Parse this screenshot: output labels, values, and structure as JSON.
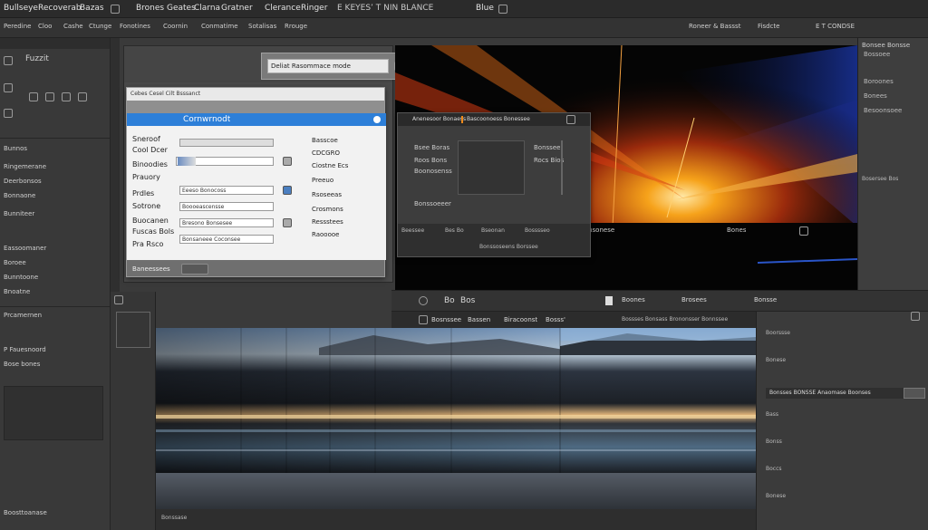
{
  "menubar": {
    "items": [
      "Bullseye",
      "Recoverab",
      "Bazas",
      "Brones",
      "Geates",
      "Clarna",
      "Gratner",
      "Clerance",
      "Ringer",
      "Blue"
    ],
    "right_text": "E KEYES’ T NIN BLANCE"
  },
  "toolbar": {
    "items": [
      "Peredine",
      "Cloo",
      "Cashe",
      "Ctunge",
      "Fonotines",
      "Coornin",
      "Conmatime",
      "Sotalisas",
      "Rrouge"
    ],
    "right_items": [
      "Roneer & Bassst",
      "Fisdcte",
      "E T CONDSE"
    ]
  },
  "leftpanel": {
    "title": "Fuzzit",
    "rows": [
      "Bunnos",
      "Ringemerane",
      "Deerbonsos",
      "Bonnaone",
      "Bunniteer",
      "Eassoomaner",
      "Boroee",
      "Bunntoone",
      "Bnoatne",
      "Prcamernen",
      "P Fauesnoord",
      "Bose bones"
    ],
    "footer": "Boosttoanase"
  },
  "topdlg": {
    "field": "Deliat Rasommace mode"
  },
  "browser": {
    "path": "Cebes Cesel Cilt Bsssanct"
  },
  "dialog": {
    "title": "Cornwrnodt",
    "left_labels": [
      "Sneroof",
      "Cool Dcer",
      "Binoodies",
      "Prauory",
      "Prdles",
      "Sotrone",
      "Buocanen",
      "Fuscas Bols",
      "Pra Rsco"
    ],
    "right_labels": [
      "Basscoe",
      "CDCGRO",
      "Ciostne Ecs",
      "Preeuo",
      "Rsoseeas",
      "Crosmons",
      "Ressstees",
      "Raooooe"
    ],
    "fields": [
      "Eeeso Bonocoss",
      "Boooeascensse",
      "Bresono Bonsesee",
      "Bonsaneee Coconsee"
    ],
    "footer_button": "Baneessees"
  },
  "subdlg": {
    "title": "Anenesoor Bonaess",
    "title2": "Bascoonoess Bonessee",
    "rows": [
      "Bsee Boras",
      "Roos Bons",
      "Boonosenss",
      "Bonssoeeer"
    ],
    "right_rows": [
      "Bonssee",
      "Rocs Bios"
    ],
    "status": "Bonssoseens Borssee",
    "bottom": [
      "Beessee",
      "Bes Bo",
      "Bseonan",
      "Bosssseo"
    ]
  },
  "preview": {
    "label": "Bonsonese",
    "right_label": "Bones"
  },
  "rightpanel": {
    "header": "Bonsee Bonsse",
    "rows": [
      "Bossoee",
      "Boroones",
      "Bonees",
      "Besoonsoee",
      "Bosersee Bos"
    ]
  },
  "timebar": {
    "items": [
      "Bo",
      "Bos",
      "Boones",
      "Brosees",
      "Bonsse"
    ]
  },
  "tabrow": {
    "tabs": [
      "Bosnssee",
      "Bassen",
      "Biracoonst",
      "Bosss'"
    ],
    "right": "Bossses Bonsass Brononsser Bonnssee"
  },
  "props": {
    "header": "Bonsses BONSSE Anaomase Boonses",
    "rows": [
      "Boorssse",
      "Bonese",
      "Bass",
      "Bonss",
      "Boccs",
      "Bonese"
    ]
  },
  "lower": {
    "status": "Bonssase"
  },
  "colors": {
    "accent": "#2d7fd8",
    "orange": "#f08a1a",
    "selection": "#2d7fd8"
  }
}
